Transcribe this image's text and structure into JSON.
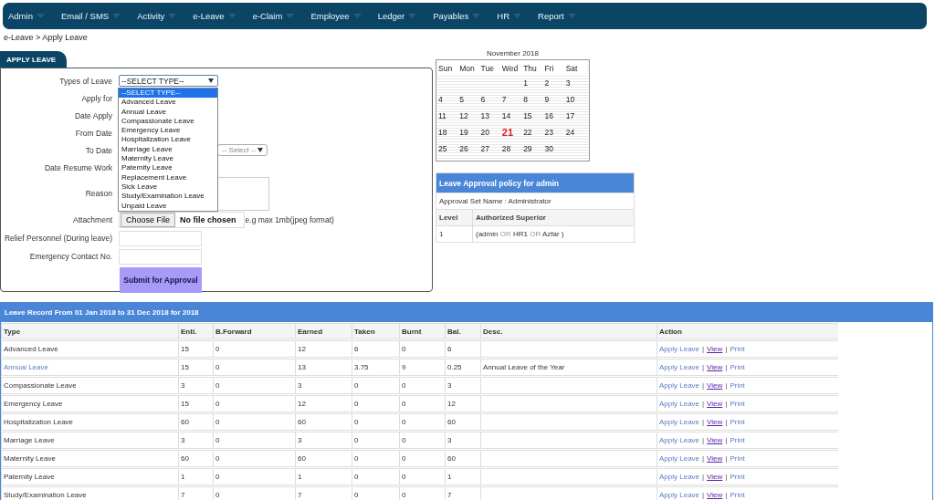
{
  "menu": [
    {
      "label": "Admin"
    },
    {
      "label": "Email / SMS"
    },
    {
      "label": "Activity"
    },
    {
      "label": "e-Leave"
    },
    {
      "label": "e-Claim"
    },
    {
      "label": "Employee"
    },
    {
      "label": "Ledger"
    },
    {
      "label": "Payables"
    },
    {
      "label": "HR"
    },
    {
      "label": "Report"
    }
  ],
  "breadcrumb": "e-Leave > Apply Leave",
  "tab": {
    "label": "APPLY LEAVE",
    "selected": true
  },
  "form": {
    "fields": [
      {
        "label": "Types of Leave",
        "kind": "select",
        "value": "--SELECT TYPE--"
      },
      {
        "label": "Apply for",
        "kind": "covered"
      },
      {
        "label": "Date Apply",
        "kind": "covered"
      },
      {
        "label": "From Date",
        "kind": "covered"
      },
      {
        "label": "To Date",
        "kind": "side-select",
        "value": "-- Select --"
      },
      {
        "label": "Date Resume Work",
        "kind": "covered"
      },
      {
        "label": "Reason",
        "kind": "textarea"
      },
      {
        "label": "Attachment",
        "kind": "file",
        "button": "Choose File",
        "status": "No file chosen",
        "hint": "e.g max 1mb(jpeg format)"
      },
      {
        "label": "Relief Personnel (During leave)",
        "kind": "text"
      },
      {
        "label": "Emergency Contact No.",
        "kind": "text"
      }
    ],
    "submit": "Submit for Approval",
    "dropdown": [
      {
        "label": "--SELECT TYPE--",
        "selected": true
      },
      {
        "label": "Advanced Leave",
        "selected": false
      },
      {
        "label": "Annual Leave",
        "selected": false
      },
      {
        "label": "Compassionate Leave",
        "selected": false
      },
      {
        "label": "Emergency Leave",
        "selected": false
      },
      {
        "label": "Hospitalization Leave",
        "selected": false
      },
      {
        "label": "Marriage Leave",
        "selected": false
      },
      {
        "label": "Maternity Leave",
        "selected": false
      },
      {
        "label": "Paternity Leave",
        "selected": false
      },
      {
        "label": "Replacement Leave",
        "selected": false
      },
      {
        "label": "Sick Leave",
        "selected": false
      },
      {
        "label": "Study/Examination Leave",
        "selected": false
      },
      {
        "label": "Unpaid Leave",
        "selected": false
      }
    ]
  },
  "calendar": {
    "title": "November 2018",
    "weekdays": [
      "Sun",
      "Mon",
      "Tue",
      "Wed",
      "Thu",
      "Fri",
      "Sat"
    ],
    "weeks": [
      {
        "days": [
          {
            "day": "1",
            "today": false
          },
          {
            "day": "2",
            "today": false
          },
          {
            "day": "3",
            "today": false
          }
        ]
      },
      {
        "days": [
          {
            "day": "4",
            "today": false
          },
          {
            "day": "5",
            "today": false
          },
          {
            "day": "6",
            "today": false
          },
          {
            "day": "7",
            "today": false
          },
          {
            "day": "8",
            "today": false
          },
          {
            "day": "9",
            "today": false
          },
          {
            "day": "10",
            "today": false
          }
        ]
      },
      {
        "days": [
          {
            "day": "11",
            "today": false
          },
          {
            "day": "12",
            "today": false
          },
          {
            "day": "13",
            "today": false
          },
          {
            "day": "14",
            "today": false
          },
          {
            "day": "15",
            "today": false
          },
          {
            "day": "16",
            "today": false
          },
          {
            "day": "17",
            "today": false
          }
        ]
      },
      {
        "days": [
          {
            "day": "18",
            "today": false
          },
          {
            "day": "19",
            "today": false
          },
          {
            "day": "20",
            "today": false
          },
          {
            "day": "21",
            "today": true
          },
          {
            "day": "22",
            "today": false
          },
          {
            "day": "23",
            "today": false
          },
          {
            "day": "24",
            "today": false
          }
        ]
      },
      {
        "days": [
          {
            "day": "25",
            "today": false
          },
          {
            "day": "26",
            "today": false
          },
          {
            "day": "27",
            "today": false
          },
          {
            "day": "28",
            "today": false
          },
          {
            "day": "29",
            "today": false
          },
          {
            "day": "30",
            "today": false
          }
        ]
      }
    ]
  },
  "policy": {
    "title": "Leave Approval policy for admin",
    "set_name": "Approval Set Name : Administrator",
    "columns": [
      "Level",
      "Authorized Superior"
    ],
    "rows": [
      {
        "level": "1",
        "approvers": [
          {
            "text": "(admin",
            "kind": "name"
          },
          {
            "text": "OR",
            "kind": "joiner"
          },
          {
            "text": "HR1",
            "kind": "name"
          },
          {
            "text": "OR",
            "kind": "joiner"
          },
          {
            "text": "Azfar )",
            "kind": "name"
          }
        ]
      }
    ]
  },
  "record": {
    "title": "Leave Record From 01 Jan 2018 to 31 Dec 2018 for 2018",
    "columns": [
      "Type",
      "Entl.",
      "B.Forward",
      "Earned",
      "Taken",
      "Burnt",
      "Bal.",
      "Desc.",
      "Action"
    ],
    "rows": [
      {
        "linked": false,
        "cells": [
          "Advanced Leave",
          "15",
          "0",
          "12",
          "6",
          "0",
          "6",
          ""
        ],
        "actions": [
          {
            "text": "Apply Leave",
            "kind": "link"
          },
          {
            "text": "|",
            "kind": "sep"
          },
          {
            "text": "View",
            "kind": "visited"
          },
          {
            "text": "|",
            "kind": "sep"
          },
          {
            "text": "Print",
            "kind": "link"
          }
        ]
      },
      {
        "linked": true,
        "cells": [
          "Annual Leave",
          "15",
          "0",
          "13",
          "3.75",
          "9",
          "0.25",
          "Annual Leave of the Year"
        ],
        "actions": [
          {
            "text": "Apply Leave",
            "kind": "link"
          },
          {
            "text": "|",
            "kind": "sep"
          },
          {
            "text": "View",
            "kind": "visited"
          },
          {
            "text": "|",
            "kind": "sep"
          },
          {
            "text": "Print",
            "kind": "link"
          }
        ]
      },
      {
        "linked": false,
        "cells": [
          "Compassionate Leave",
          "3",
          "0",
          "3",
          "0",
          "0",
          "3",
          ""
        ],
        "actions": [
          {
            "text": "Apply Leave",
            "kind": "link"
          },
          {
            "text": "|",
            "kind": "sep"
          },
          {
            "text": "View",
            "kind": "visited"
          },
          {
            "text": "|",
            "kind": "sep"
          },
          {
            "text": "Print",
            "kind": "link"
          }
        ]
      },
      {
        "linked": false,
        "cells": [
          "Emergency Leave",
          "15",
          "0",
          "12",
          "0",
          "0",
          "12",
          ""
        ],
        "actions": [
          {
            "text": "Apply Leave",
            "kind": "link"
          },
          {
            "text": "|",
            "kind": "sep"
          },
          {
            "text": "View",
            "kind": "visited"
          },
          {
            "text": "|",
            "kind": "sep"
          },
          {
            "text": "Print",
            "kind": "link"
          }
        ]
      },
      {
        "linked": false,
        "cells": [
          "Hospitalization Leave",
          "60",
          "0",
          "60",
          "0",
          "0",
          "60",
          ""
        ],
        "actions": [
          {
            "text": "Apply Leave",
            "kind": "link"
          },
          {
            "text": "|",
            "kind": "sep"
          },
          {
            "text": "View",
            "kind": "visited"
          },
          {
            "text": "|",
            "kind": "sep"
          },
          {
            "text": "Print",
            "kind": "link"
          }
        ]
      },
      {
        "linked": false,
        "cells": [
          "Marriage Leave",
          "3",
          "0",
          "3",
          "0",
          "0",
          "3",
          ""
        ],
        "actions": [
          {
            "text": "Apply Leave",
            "kind": "link"
          },
          {
            "text": "|",
            "kind": "sep"
          },
          {
            "text": "View",
            "kind": "visited"
          },
          {
            "text": "|",
            "kind": "sep"
          },
          {
            "text": "Print",
            "kind": "link"
          }
        ]
      },
      {
        "linked": false,
        "cells": [
          "Maternity Leave",
          "60",
          "0",
          "60",
          "0",
          "0",
          "60",
          ""
        ],
        "actions": [
          {
            "text": "Apply Leave",
            "kind": "link"
          },
          {
            "text": "|",
            "kind": "sep"
          },
          {
            "text": "View",
            "kind": "visited"
          },
          {
            "text": "|",
            "kind": "sep"
          },
          {
            "text": "Print",
            "kind": "link"
          }
        ]
      },
      {
        "linked": false,
        "cells": [
          "Paternity Leave",
          "1",
          "0",
          "1",
          "0",
          "0",
          "1",
          ""
        ],
        "actions": [
          {
            "text": "Apply Leave",
            "kind": "link"
          },
          {
            "text": "|",
            "kind": "sep"
          },
          {
            "text": "View",
            "kind": "visited"
          },
          {
            "text": "|",
            "kind": "sep"
          },
          {
            "text": "Print",
            "kind": "link"
          }
        ]
      },
      {
        "linked": false,
        "cells": [
          "Study/Examination Leave",
          "7",
          "0",
          "7",
          "0",
          "0",
          "7",
          ""
        ],
        "actions": [
          {
            "text": "Apply Leave",
            "kind": "link"
          },
          {
            "text": "|",
            "kind": "sep"
          },
          {
            "text": "View",
            "kind": "visited"
          },
          {
            "text": "|",
            "kind": "sep"
          },
          {
            "text": "Print",
            "kind": "link"
          }
        ]
      }
    ]
  }
}
